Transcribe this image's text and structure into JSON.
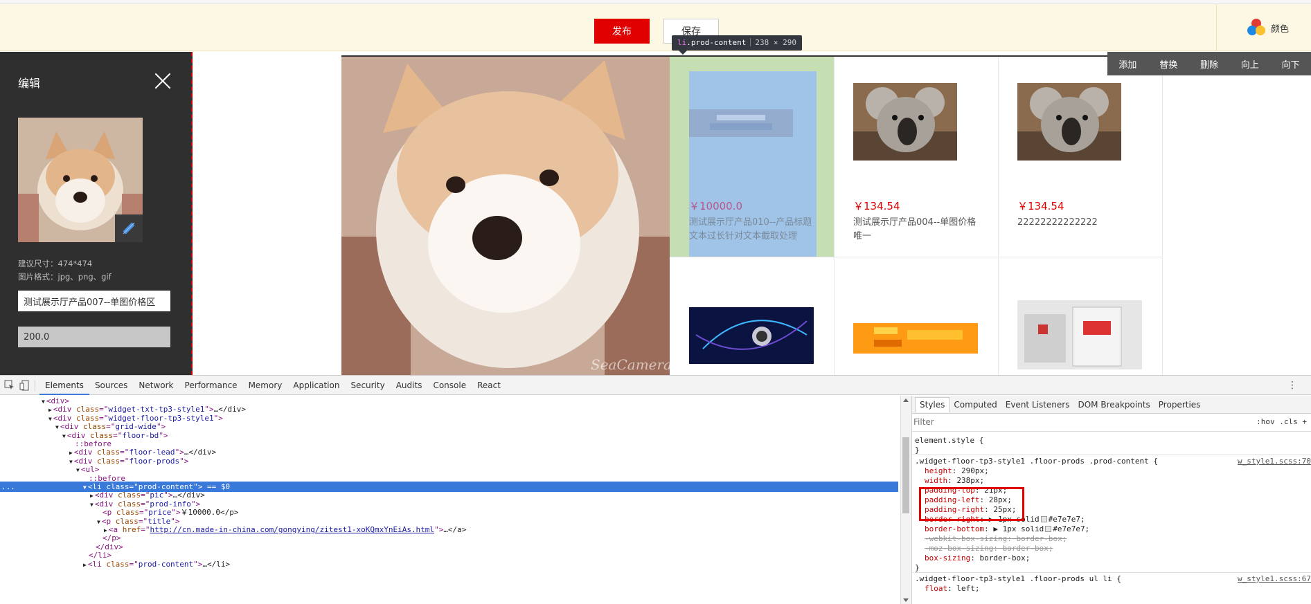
{
  "toolbar": {
    "publish_label": "发布",
    "save_label": "保存",
    "color_label": "颜色"
  },
  "inspect_tooltip": {
    "tag": "li",
    "class": ".prod-content",
    "dims": "238 × 290"
  },
  "colors": {
    "publish": "#e00000",
    "panel_bg": "#2f2f2f",
    "price": "#e00000",
    "highlight_content": "#a0c4e8",
    "highlight_padding": "#c5dfb3",
    "selection": "#3879d9"
  },
  "left_panel": {
    "title": "编辑",
    "size_hint": "建议尺寸：474*474",
    "format_hint": "图片格式：jpg、png、gif",
    "title_value": "测试展示厅产品007--单图价格区",
    "price_value": "200.0"
  },
  "actions": [
    "添加",
    "替换",
    "删除",
    "向上",
    "向下"
  ],
  "lead_image": {
    "watermark": "SeaCamera"
  },
  "products": [
    {
      "price": "￥10000.0",
      "title": "测试展示厅产品010--产品标题文本过长针对文本截取处理",
      "image": "banner-icon"
    },
    {
      "price": "￥134.54",
      "title": "测试展示厅产品004--单图价格唯一",
      "image": "koala-icon"
    },
    {
      "price": "￥134.54",
      "title": "22222222222222",
      "image": "koala-icon"
    },
    {
      "price": "",
      "title": "",
      "image": "tech-banner-icon"
    },
    {
      "price": "",
      "title": "",
      "image": "orange-banner-icon"
    },
    {
      "price": "",
      "title": "",
      "image": "box-photo-icon"
    }
  ],
  "devtools": {
    "tabs": [
      "Elements",
      "Sources",
      "Network",
      "Performance",
      "Memory",
      "Application",
      "Security",
      "Audits",
      "Console",
      "React"
    ],
    "active_tab": "Elements",
    "style_tabs": [
      "Styles",
      "Computed",
      "Event Listeners",
      "DOM Breakpoints",
      "Properties"
    ],
    "filter_placeholder": "Filter",
    "filter_tools": ":hov  .cls  +",
    "dom": [
      {
        "indent": 60,
        "arrow": "▼",
        "html": "<div>"
      },
      {
        "indent": 70,
        "arrow": "▶",
        "tag": "div",
        "attr": "class",
        "val": "widget-txt-tp3-style1",
        "tail": "…</div>"
      },
      {
        "indent": 70,
        "arrow": "▼",
        "tag": "div",
        "attr": "class",
        "val": "widget-floor-tp3-style1",
        "tail": ""
      },
      {
        "indent": 80,
        "arrow": "▼",
        "tag": "div",
        "attr": "class",
        "val": "grid-wide",
        "tail": ""
      },
      {
        "indent": 90,
        "arrow": "▼",
        "tag": "div",
        "attr": "class",
        "val": "floor-bd",
        "tail": ""
      },
      {
        "indent": 108,
        "arrow": "",
        "pseudo": "::before"
      },
      {
        "indent": 100,
        "arrow": "▶",
        "tag": "div",
        "attr": "class",
        "val": "floor-lead",
        "tail": "…</div>"
      },
      {
        "indent": 100,
        "arrow": "▼",
        "tag": "div",
        "attr": "class",
        "val": "floor-prods",
        "tail": ""
      },
      {
        "indent": 110,
        "arrow": "▼",
        "html": "<ul>"
      },
      {
        "indent": 128,
        "arrow": "",
        "pseudo": "::before"
      },
      {
        "indent": 120,
        "arrow": "▼",
        "tag": "li",
        "attr": "class",
        "val": "prod-content",
        "tail": " == $0",
        "selected": true
      },
      {
        "indent": 130,
        "arrow": "▶",
        "tag": "div",
        "attr": "class",
        "val": "pic",
        "tail": "…</div>"
      },
      {
        "indent": 130,
        "arrow": "▼",
        "tag": "div",
        "attr": "class",
        "val": "prod-info",
        "tail": ""
      },
      {
        "indent": 148,
        "arrow": "",
        "tag": "p",
        "attr": "class",
        "val": "price",
        "tail": "￥10000.0</p>"
      },
      {
        "indent": 140,
        "arrow": "▼",
        "tag": "p",
        "attr": "class",
        "val": "title",
        "tail": ""
      },
      {
        "indent": 150,
        "arrow": "▶",
        "tag": "a",
        "attr": "href",
        "val": "http://cn.made-in-china.com/gongying/zitest1-xoKQmxYnEiAs.html",
        "tail": "…</a>",
        "link": true
      },
      {
        "indent": 148,
        "arrow": "",
        "html": "</p>"
      },
      {
        "indent": 138,
        "arrow": "",
        "html": "</div>"
      },
      {
        "indent": 128,
        "arrow": "",
        "html": "</li>"
      },
      {
        "indent": 120,
        "arrow": "▶",
        "tag": "li",
        "attr": "class",
        "val": "prod-content",
        "tail": "…</li>"
      }
    ],
    "selected_ellipsis": "...",
    "styles": [
      {
        "kind": "rule",
        "text": "element.style {"
      },
      {
        "kind": "close",
        "text": "}"
      },
      {
        "kind": "rule",
        "text": ".widget-floor-tp3-style1 .floor-prods .prod-content {",
        "src": "w_style1.scss:70"
      },
      {
        "kind": "decl",
        "prop": "height",
        "val": "290px;"
      },
      {
        "kind": "decl",
        "prop": "width",
        "val": "238px;"
      },
      {
        "kind": "decl",
        "prop": "padding-top",
        "val": "21px;"
      },
      {
        "kind": "decl",
        "prop": "padding-left",
        "val": "28px;"
      },
      {
        "kind": "decl",
        "prop": "padding-right",
        "val": "25px;"
      },
      {
        "kind": "decl",
        "prop": "border-right",
        "val": "▶ 1px solid",
        "color": "#e7e7e7;"
      },
      {
        "kind": "decl",
        "prop": "border-bottom",
        "val": "▶ 1px solid",
        "color": "#e7e7e7;"
      },
      {
        "kind": "strike",
        "prop": "-webkit-box-sizing",
        "val": "border-box;"
      },
      {
        "kind": "strike",
        "prop": "-moz-box-sizing",
        "val": "border-box;"
      },
      {
        "kind": "decl",
        "prop": "box-sizing",
        "val": "border-box;"
      },
      {
        "kind": "close",
        "text": "}"
      },
      {
        "kind": "rule",
        "text": ".widget-floor-tp3-style1 .floor-prods ul li {",
        "src": "w_style1.scss:67"
      },
      {
        "kind": "decl",
        "prop": "float",
        "val": "left;"
      }
    ]
  }
}
